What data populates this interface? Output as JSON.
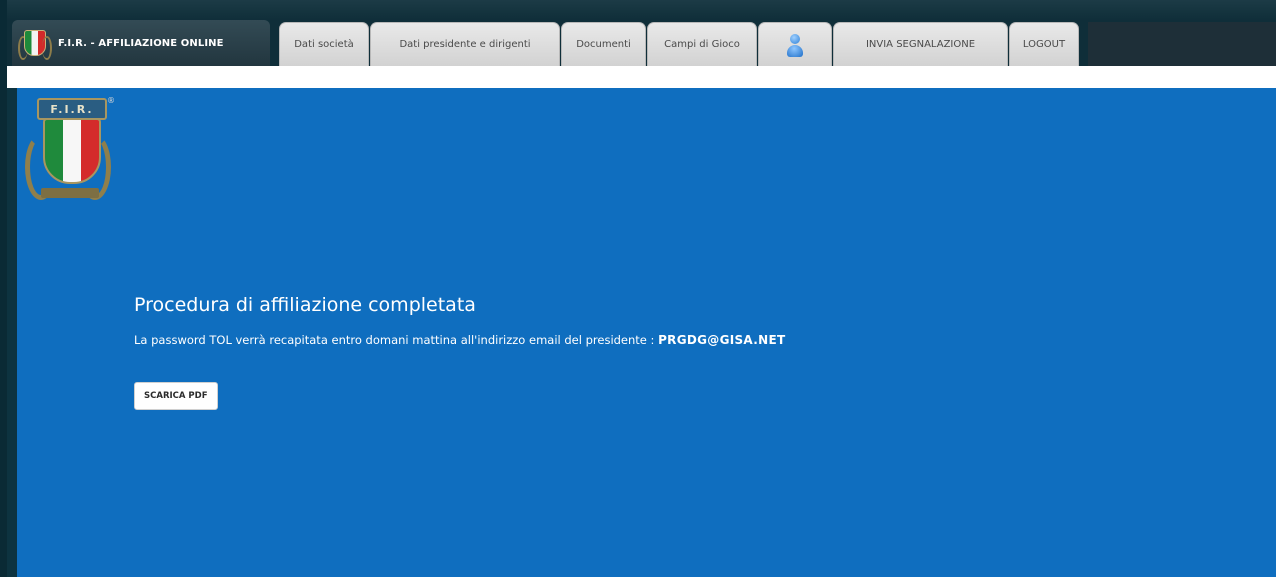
{
  "header": {
    "brand_title": "F.I.R. - AFFILIAZIONE ONLINE",
    "tabs": [
      {
        "label": "Dati società"
      },
      {
        "label": "Dati presidente e dirigenti"
      },
      {
        "label": "Documenti"
      },
      {
        "label": "Campi di Gioco"
      },
      {
        "label": "",
        "icon": "user-icon"
      },
      {
        "label": "INVIA SEGNALAZIONE"
      },
      {
        "label": "LOGOUT"
      }
    ]
  },
  "logo": {
    "banner_text": "F.I.R.",
    "registered_mark": "®"
  },
  "main": {
    "title": "Procedura di affiliazione completata",
    "message_prefix": "La password TOL verrà recapitata entro domani mattina all'indirizzo email del presidente : ",
    "email": "PRGDG@GISA.NET",
    "download_button": "SCARICA PDF"
  },
  "colors": {
    "content_background": "#0f6ebf",
    "frame_background": "#0d3340",
    "tab_background": "#dcdcdc"
  }
}
